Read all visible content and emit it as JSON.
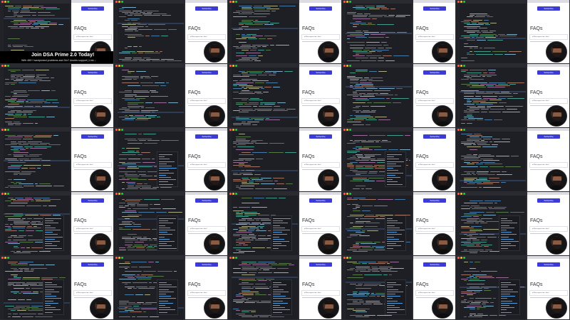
{
  "promo": {
    "title": "Join DSA Prime 2.0 Today!",
    "subtitle": "With 450+ handpicked problems and 24x7 doubts support | Link ↓"
  },
  "preview": {
    "button_label": "Subscribe",
    "faq_heading": "FAQs",
    "faq_item_label": "▸ What payment do I take?"
  },
  "colors": {
    "background": "#1b1b1f",
    "editor": "#1e1f24",
    "accent_button": "#3a3bd8",
    "preview_bg": "#ffffff"
  },
  "grid": {
    "rows": 5,
    "columns": 5
  }
}
